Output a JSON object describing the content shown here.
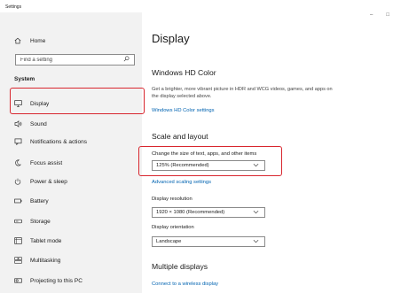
{
  "window": {
    "title": "Settings",
    "controls": {
      "minimize": "–",
      "maximize": "□"
    }
  },
  "sidebar": {
    "home": {
      "label": "Home",
      "icon": "home-icon"
    },
    "search": {
      "placeholder": "Find a setting"
    },
    "section": "System",
    "items": [
      {
        "label": "Display",
        "icon": "monitor-icon",
        "selected": true
      },
      {
        "label": "Sound",
        "icon": "speaker-icon"
      },
      {
        "label": "Notifications & actions",
        "icon": "notifications-icon"
      },
      {
        "label": "Focus assist",
        "icon": "moon-icon"
      },
      {
        "label": "Power & sleep",
        "icon": "power-icon"
      },
      {
        "label": "Battery",
        "icon": "battery-icon"
      },
      {
        "label": "Storage",
        "icon": "storage-icon"
      },
      {
        "label": "Tablet mode",
        "icon": "tablet-icon"
      },
      {
        "label": "Multitasking",
        "icon": "multitasking-icon"
      },
      {
        "label": "Projecting to this PC",
        "icon": "projector-icon"
      }
    ]
  },
  "main": {
    "title": "Display",
    "hd_color": {
      "heading": "Windows HD Color",
      "description": "Get a brighter, more vibrant picture in HDR and WCG videos, games, and apps on the display selected above.",
      "link": "Windows HD Color settings"
    },
    "scale_layout": {
      "heading": "Scale and layout",
      "scale_label": "Change the size of text, apps, and other items",
      "scale_value": "125% (Recommended)",
      "advanced_link": "Advanced scaling settings",
      "resolution_label": "Display resolution",
      "resolution_value": "1920 × 1080 (Recommended)",
      "orientation_label": "Display orientation",
      "orientation_value": "Landscape"
    },
    "multiple_displays": {
      "heading": "Multiple displays",
      "link": "Connect to a wireless display"
    }
  },
  "colors": {
    "accent_link": "#0063b1",
    "highlight_box": "#d8262e",
    "sidebar_bg": "#f2f2f2"
  }
}
